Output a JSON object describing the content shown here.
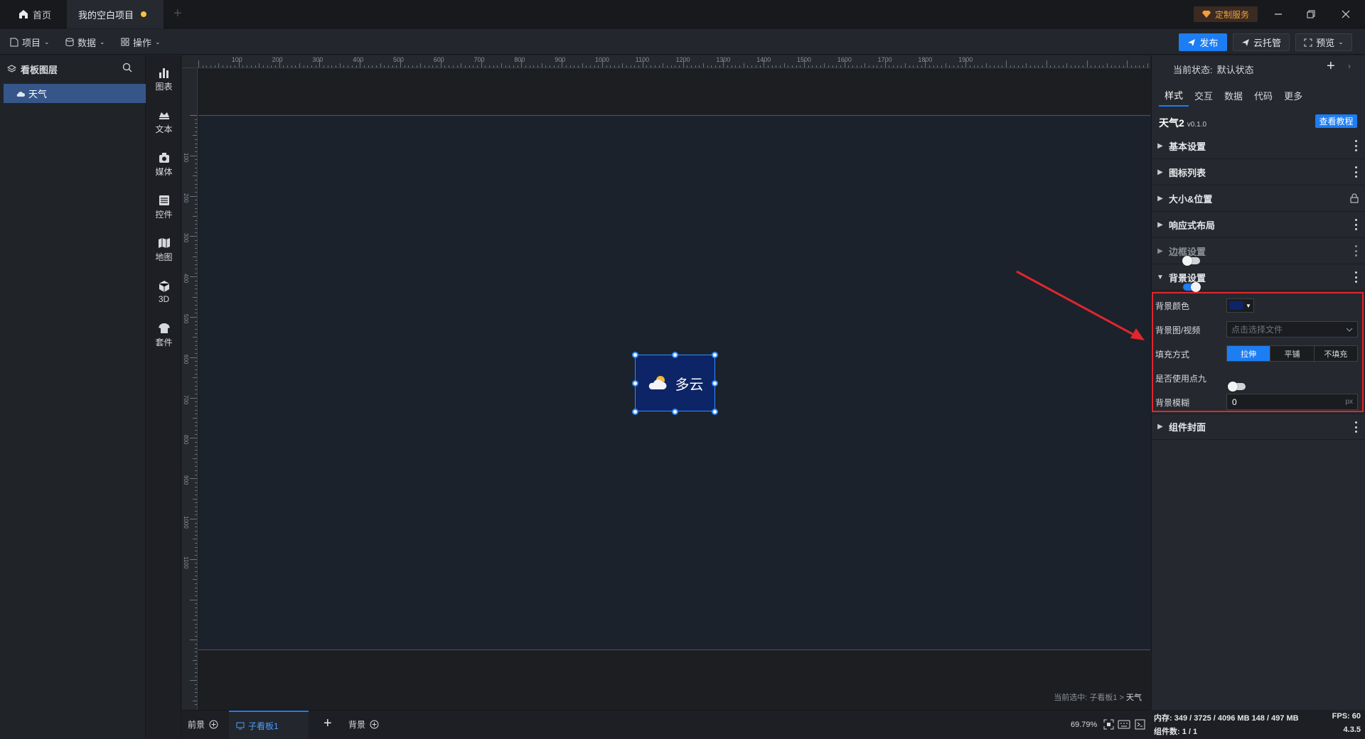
{
  "titlebar": {
    "tabs": [
      {
        "label": "首页"
      },
      {
        "label": "我的空白项目"
      }
    ],
    "custom_service": "定制服务"
  },
  "menubar": {
    "menus": [
      {
        "label": "项目"
      },
      {
        "label": "数据"
      },
      {
        "label": "操作"
      }
    ],
    "publish": "发布",
    "cloud": "云托管",
    "preview": "预览"
  },
  "layers": {
    "title": "看板图层",
    "items": [
      {
        "label": "天气"
      }
    ]
  },
  "palette": {
    "items": [
      {
        "label": "图表",
        "icon": "chart-icon"
      },
      {
        "label": "文本",
        "icon": "text-icon"
      },
      {
        "label": "媒体",
        "icon": "media-icon"
      },
      {
        "label": "控件",
        "icon": "widget-icon"
      },
      {
        "label": "地图",
        "icon": "map-icon"
      },
      {
        "label": "3D",
        "icon": "cube-icon"
      },
      {
        "label": "套件",
        "icon": "kit-icon"
      }
    ]
  },
  "ruler": {
    "top": [
      "100",
      "200",
      "300",
      "400",
      "500",
      "600",
      "700",
      "800",
      "900",
      "1000",
      "1100",
      "1200",
      "1300",
      "1400",
      "1500",
      "1600",
      "1700",
      "1800",
      "1900"
    ],
    "left": [
      "100",
      "200",
      "300",
      "400",
      "500",
      "600",
      "700",
      "800",
      "900",
      "1000",
      "1100"
    ]
  },
  "widget": {
    "text": "多云"
  },
  "canvas": {
    "selection_label": "当前选中: 子看板1 > ",
    "selection_item": "天气"
  },
  "bottombar": {
    "foreground": "前景",
    "sub_board": "子看板1",
    "background": "背景",
    "zoom": "69.79%"
  },
  "rightpanel": {
    "state_label": "当前状态:",
    "state_value": "默认状态",
    "tabs": [
      {
        "label": "样式"
      },
      {
        "label": "交互"
      },
      {
        "label": "数据"
      },
      {
        "label": "代码"
      },
      {
        "label": "更多"
      }
    ],
    "component_name": "天气2",
    "component_version": "v0.1.0",
    "tutorial": "查看教程",
    "sections": [
      {
        "label": "基本设置"
      },
      {
        "label": "图标列表"
      },
      {
        "label": "大小&位置"
      },
      {
        "label": "响应式布局"
      },
      {
        "label": "边框设置"
      },
      {
        "label": "背景设置"
      }
    ],
    "bg": {
      "color_label": "背景颜色",
      "color_value": "#0d2466",
      "media_label": "背景图/视频",
      "media_placeholder": "点击选择文件",
      "fill_label": "填充方式",
      "fill_options": [
        {
          "label": "拉伸"
        },
        {
          "label": "平铺"
        },
        {
          "label": "不填充"
        }
      ],
      "nine_label": "是否使用点九",
      "blur_label": "背景模糊",
      "blur_value": "0",
      "blur_unit": "px"
    },
    "cover_label": "组件封面"
  },
  "status": {
    "memory": "内存:  349 / 3725 / 4096 MB  148 / 497 MB",
    "fps": "FPS:  60",
    "components": "组件数: 1 / 1",
    "version": "4.3.5"
  },
  "colors": {
    "accent": "#1d7df2",
    "highlight": "#e0262e"
  }
}
